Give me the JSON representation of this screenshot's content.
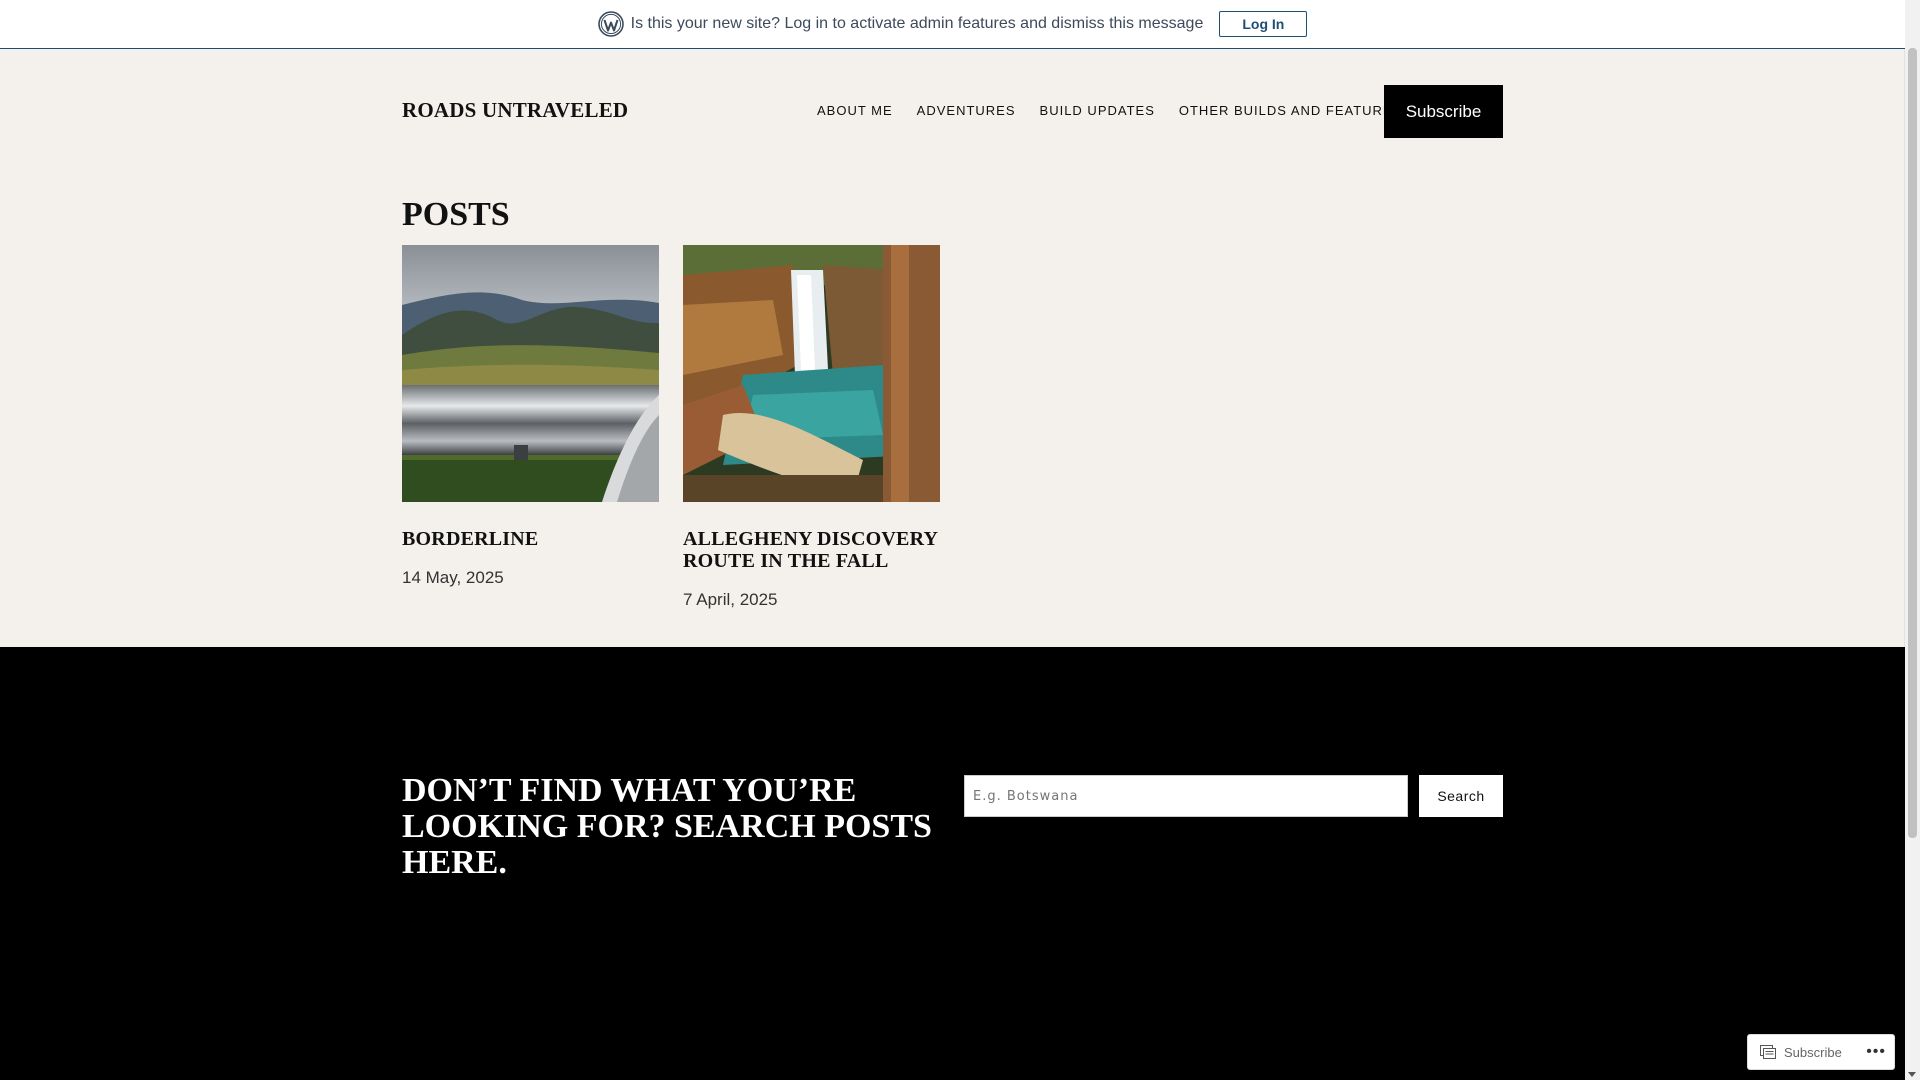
{
  "notice": {
    "message": "Is this your new site? Log in to activate admin features and dismiss this message",
    "login_label": "Log In"
  },
  "header": {
    "site_title": "ROADS UNTRAVELED",
    "nav": [
      "ABOUT ME",
      "ADVENTURES",
      "BUILD UPDATES",
      "OTHER BUILDS AND FEATURES"
    ],
    "subscribe_label": "Subscribe"
  },
  "posts": {
    "heading": "POSTS",
    "items": [
      {
        "title": "BORDERLINE",
        "date": "14 May, 2025"
      },
      {
        "title": "ALLEGHENY DISCOVERY ROUTE IN THE FALL",
        "date": "7 April, 2025"
      }
    ]
  },
  "footer": {
    "cta": "DON’T FIND WHAT YOU’RE LOOKING FOR? SEARCH POSTS HERE.",
    "search_placeholder": "E.g. Botswana",
    "search_label": "Search"
  },
  "floating": {
    "subscribe_label": "Subscribe",
    "more_label": "•••"
  },
  "icons": {
    "wordpress": "wordpress-logo-icon",
    "reader": "reader-icon",
    "more": "more-dots-icon"
  },
  "colors": {
    "page_bg": "#f4f1ec",
    "footer_bg": "#000000",
    "notice_accent": "#1d4f73"
  }
}
